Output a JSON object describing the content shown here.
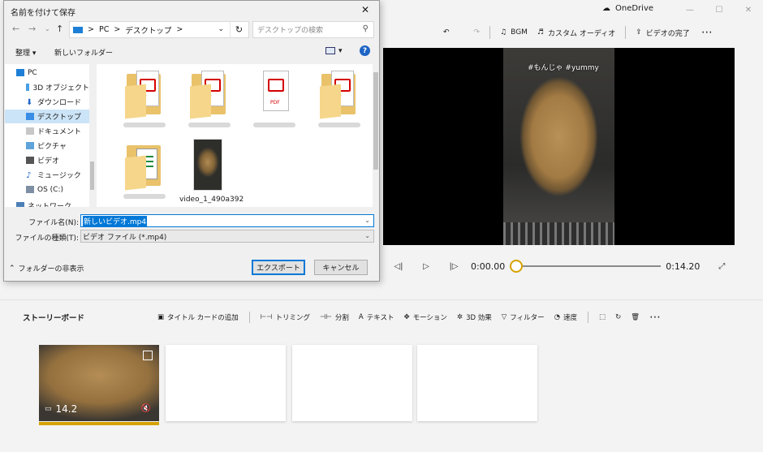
{
  "app": {
    "onedrive_label": "OneDrive",
    "toolbar": {
      "bgm": "BGM",
      "custom_audio": "カスタム オーディオ",
      "finish_video": "ビデオの完了"
    },
    "preview": {
      "hashtag": "#もんじゃ  #yummy"
    },
    "playback": {
      "current_time": "0:00.00",
      "total_time": "0:14.20",
      "progress": 0.0
    },
    "storyboard": {
      "title": "ストーリーボード",
      "tools": [
        "タイトル カードの追加",
        "トリミング",
        "分割",
        "テキスト",
        "モーション",
        "3D 効果",
        "フィルター",
        "速度"
      ],
      "clip_duration": "14.2"
    }
  },
  "dialog": {
    "title": "名前を付けて保存",
    "breadcrumb": [
      "PC",
      "デスクトップ"
    ],
    "search_placeholder": "デスクトップの検索",
    "organize": "整理",
    "new_folder": "新しいフォルダー",
    "nav_items": [
      {
        "label": "PC",
        "icon": "pc-icon"
      },
      {
        "label": "3D オブジェクト",
        "icon": "3d-objects-icon"
      },
      {
        "label": "ダウンロード",
        "icon": "download-icon"
      },
      {
        "label": "デスクトップ",
        "icon": "desktop-icon",
        "selected": true
      },
      {
        "label": "ドキュメント",
        "icon": "documents-icon"
      },
      {
        "label": "ピクチャ",
        "icon": "pictures-icon"
      },
      {
        "label": "ビデオ",
        "icon": "videos-icon"
      },
      {
        "label": "ミュージック",
        "icon": "music-icon"
      },
      {
        "label": "OS (C:)",
        "icon": "drive-icon"
      },
      {
        "label": "ネットワーク",
        "icon": "network-icon"
      }
    ],
    "video_file_name": "video_1_490a392",
    "file_name_label": "ファイル名(N):",
    "file_name_value": "新しいビデオ.mp4",
    "file_type_label": "ファイルの種類(T):",
    "file_type_value": "ビデオ ファイル (*.mp4)",
    "hide_folders": "フォルダーの非表示",
    "export_button": "エクスポート",
    "cancel_button": "キャンセル"
  },
  "colors": {
    "accent_gold": "#d6a100",
    "selection_blue": "#0078d7"
  }
}
